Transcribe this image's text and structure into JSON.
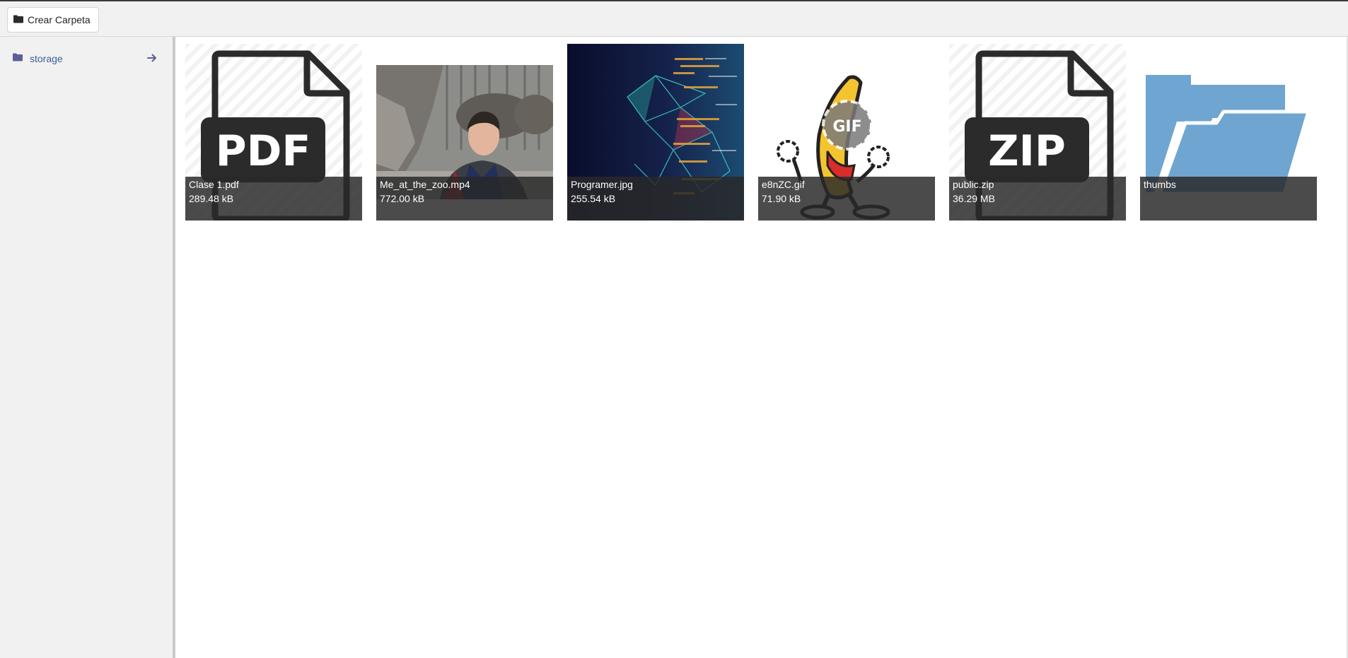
{
  "toolbar": {
    "create_folder_label": "Crear Carpeta",
    "create_folder_icon": "folder-icon"
  },
  "sidebar": {
    "items": [
      {
        "label": "storage",
        "icon": "folder-icon",
        "action_icon": "arrow-right-icon"
      }
    ]
  },
  "files": [
    {
      "name": "Clase 1.pdf",
      "size": "289.48 kB",
      "kind": "pdf",
      "thumb_text": "PDF"
    },
    {
      "name": "Me_at_the_zoo.mp4",
      "size": "772.00 kB",
      "kind": "video"
    },
    {
      "name": "Programer.jpg",
      "size": "255.54 kB",
      "kind": "image"
    },
    {
      "name": "e8nZC.gif",
      "size": "71.90 kB",
      "kind": "gif",
      "thumb_text": "GIF"
    },
    {
      "name": "public.zip",
      "size": "36.29 MB",
      "kind": "zip",
      "thumb_text": "ZIP"
    },
    {
      "name": "thumbs",
      "size": "",
      "kind": "folder"
    }
  ],
  "colors": {
    "accent": "#3a5f9a",
    "sidebar_icon": "#5b5f97",
    "folder": "#6fa5d1",
    "caption_bg": "#282828"
  }
}
